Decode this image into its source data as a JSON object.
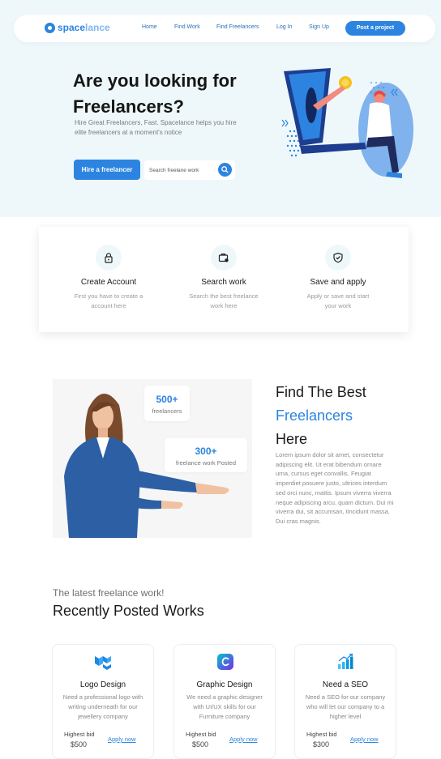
{
  "brand": {
    "name_part1": "space",
    "name_part2": "lance",
    "primary_color": "#2c84e0"
  },
  "nav": {
    "links": [
      "Home",
      "Find Work",
      "Find Freelancers",
      "Log In",
      "Sign Up"
    ],
    "cta": "Post a project"
  },
  "hero": {
    "title_line1": "Are you looking for",
    "title_line2": "Freelancers?",
    "subtitle": "Hire Great Freelancers, Fast. Spacelance helps you hire elite freelancers at a moment's notice",
    "hire_button": "Hire a freelancer",
    "search_placeholder": "Search freelane work"
  },
  "steps": [
    {
      "title": "Create Account",
      "desc": "First you have to create a account here",
      "icon": "lock-icon"
    },
    {
      "title": "Search work",
      "desc": "Search the best freelance work here",
      "icon": "briefcase-search-icon"
    },
    {
      "title": "Save and apply",
      "desc": "Apply or save and start your work",
      "icon": "shield-check-icon"
    }
  ],
  "stats": [
    {
      "number": "500+",
      "label": "freelancers"
    },
    {
      "number": "300+",
      "label": "freelance work Posted"
    }
  ],
  "find": {
    "line1": "Find The Best",
    "line2": "Freelancers",
    "line3": "Here",
    "body": "Lorem ipsum dolor sit amet, consectetur adipiscing elit. Ut erat bibendum ornare urna, cursus eget convallis. Feugiat imperdiet posuere justo, ultrices interdum sed orci nunc, mattis. Ipsum viverra viverra neque adipiscing arcu, quam dictum. Dui mi viverra dui, sit accumsan, tincidunt massa. Dui cras magnis."
  },
  "latest": {
    "eyebrow": "The latest freelance work!",
    "title": "Recently Posted Works",
    "jobs": [
      {
        "title": "Logo Design",
        "desc": "Need a professional logo with writing underneath for our jewellery company",
        "bid_label": "Highest bid",
        "bid": "$500",
        "apply": "Apply now",
        "icon": "mui-logo-icon"
      },
      {
        "title": "Graphic Design",
        "desc": "We need a graphic designer with UI/UX skills for our Furniture company",
        "bid_label": "Highest bid",
        "bid": "$500",
        "apply": "Apply now",
        "icon": "canva-logo-icon"
      },
      {
        "title": "Need a SEO",
        "desc": "Need a SEO for our company who will let our company to a higher level",
        "bid_label": "Highest bid",
        "bid": "$300",
        "apply": "Apply now",
        "icon": "seo-chart-icon"
      }
    ]
  }
}
